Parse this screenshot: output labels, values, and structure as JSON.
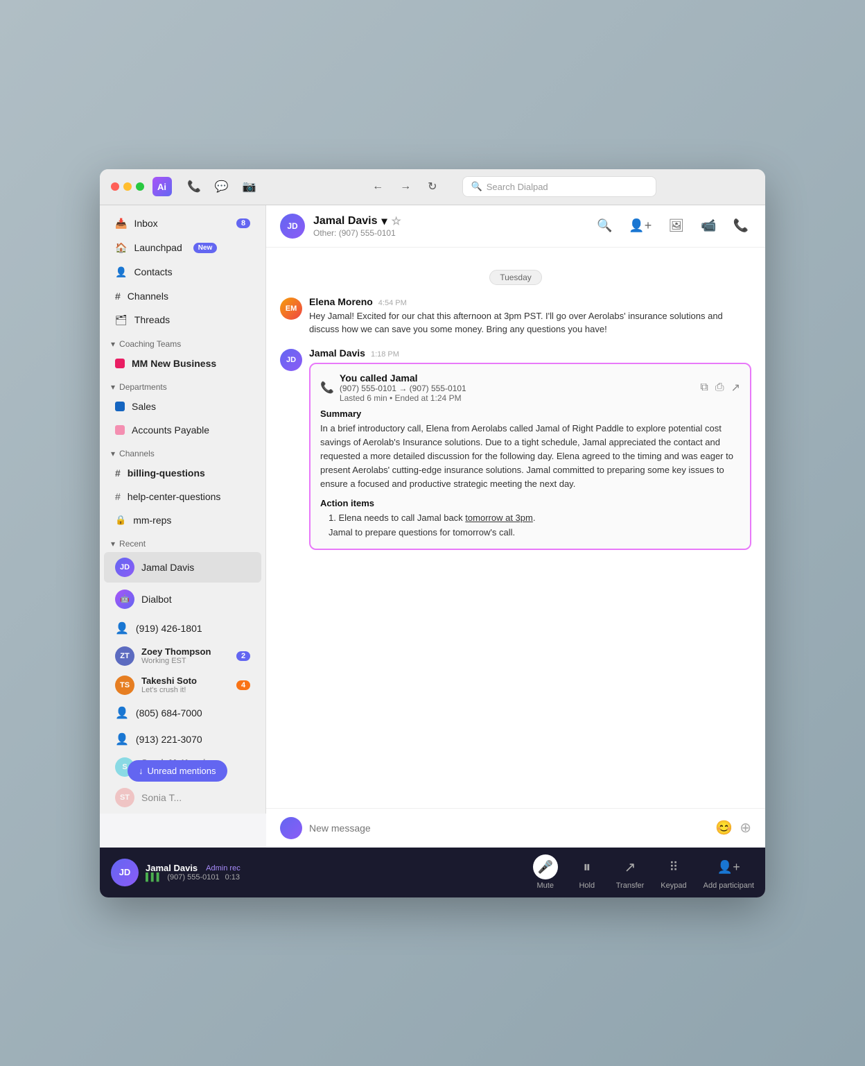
{
  "titlebar": {
    "app_icon_label": "Ai",
    "search_placeholder": "Search Dialpad"
  },
  "sidebar": {
    "inbox_label": "Inbox",
    "inbox_badge": "8",
    "launchpad_label": "Launchpad",
    "launchpad_new": "New",
    "contacts_label": "Contacts",
    "channels_label": "Channels",
    "threads_label": "Threads",
    "coaching_section": "Coaching Teams",
    "mm_new_business": "MM New Business",
    "departments_section": "Departments",
    "sales_label": "Sales",
    "accounts_payable_label": "Accounts Payable",
    "channels_section": "Channels",
    "billing_questions_label": "billing-questions",
    "help_center_label": "help-center-questions",
    "mm_reps_label": "mm-reps",
    "recent_section": "Recent",
    "recent_items": [
      {
        "name": "Jamal Davis",
        "sub": "",
        "type": "person",
        "active": true
      },
      {
        "name": "Dialbot",
        "sub": "",
        "type": "bot"
      },
      {
        "name": "(919) 426-1801",
        "sub": "",
        "type": "phone"
      },
      {
        "name": "Zoey Thompson",
        "sub": "Working EST",
        "type": "person",
        "badge": "2"
      },
      {
        "name": "Takeshi Soto",
        "sub": "Let's crush it!",
        "type": "person",
        "badge": "4"
      },
      {
        "name": "(805) 684-7000",
        "sub": "",
        "type": "phone"
      },
      {
        "name": "(913) 221-3070",
        "sub": "",
        "type": "phone"
      },
      {
        "name": "Sarah McKenzie",
        "sub": "oo...",
        "type": "person",
        "faded": true
      },
      {
        "name": "Sonia T...",
        "sub": "",
        "type": "person",
        "faded": true
      }
    ],
    "unread_mentions_btn": "Unread mentions"
  },
  "chat_header": {
    "name": "Jamal Davis",
    "phone": "(907) 555-0101",
    "phone_label": "Other:"
  },
  "messages": {
    "date_divider": "Tuesday",
    "elena_name": "Elena Moreno",
    "elena_time": "4:54 PM",
    "elena_text": "Hey Jamal! Excited for our chat this afternoon at 3pm PST. I'll go over Aerolabs' insurance solutions and discuss how we can save you some money. Bring any questions you have!",
    "jamal_name": "Jamal Davis",
    "jamal_time": "1:18 PM",
    "call_card": {
      "title": "You called Jamal",
      "route": "(907) 555-0101 → (907) 555-0101",
      "duration": "Lasted 6 min • Ended at 1:24 PM",
      "summary_title": "Summary",
      "summary_text": "In a brief introductory call, Elena from Aerolabs called Jamal of Right Paddle to explore potential cost savings of Aerolab's Insurance  solutions. Due to a tight schedule, Jamal appreciated the contact and requested a more detailed discussion for the following day. Elena agreed to the timing and was eager to present Aerolabs' cutting-edge insurance solutions. Jamal committed to preparing some key issues to ensure a focused and productive strategic meeting the next day.",
      "action_items_title": "Action items",
      "action_item_1_pre": "Elena needs to call Jamal back ",
      "action_item_1_link": "tomorrow at 3pm",
      "action_item_1_post": ".",
      "action_item_2": "Jamal to prepare questions for tomorrow's call."
    }
  },
  "message_input": {
    "placeholder": "New message"
  },
  "call_bar": {
    "name": "Jamal Davis",
    "phone": "(907) 555-0101",
    "admin_label": "Admin rec",
    "timer": "0:13",
    "mute_label": "Mute",
    "hold_label": "Hold",
    "transfer_label": "Transfer",
    "keypad_label": "Keypad",
    "add_participant_label": "Add participant"
  }
}
